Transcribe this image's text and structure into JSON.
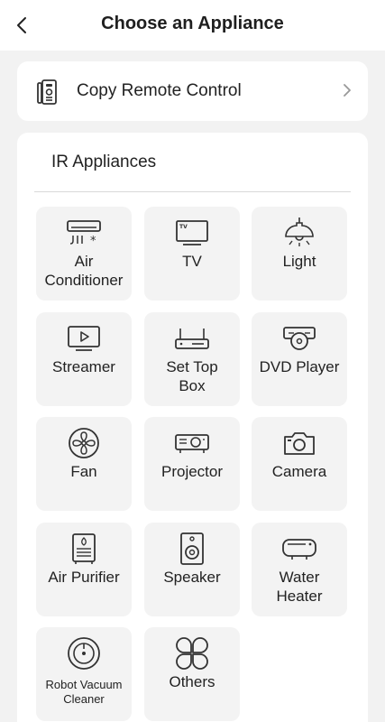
{
  "header": {
    "title": "Choose an Appliance",
    "back_icon": "chevron-left-icon"
  },
  "copy_remote": {
    "label": "Copy Remote Control",
    "icon": "remote-copy-icon",
    "chevron": "chevron-right-icon"
  },
  "section": {
    "title": "IR Appliances"
  },
  "appliances": [
    {
      "label": "Air\nConditioner",
      "icon": "air-conditioner-icon"
    },
    {
      "label": "TV",
      "icon": "tv-icon"
    },
    {
      "label": "Light",
      "icon": "light-icon"
    },
    {
      "label": "Streamer",
      "icon": "streamer-icon"
    },
    {
      "label": "Set Top\nBox",
      "icon": "set-top-box-icon"
    },
    {
      "label": "DVD Player",
      "icon": "dvd-player-icon"
    },
    {
      "label": "Fan",
      "icon": "fan-icon"
    },
    {
      "label": "Projector",
      "icon": "projector-icon"
    },
    {
      "label": "Camera",
      "icon": "camera-icon"
    },
    {
      "label": "Air Purifier",
      "icon": "air-purifier-icon"
    },
    {
      "label": "Speaker",
      "icon": "speaker-icon"
    },
    {
      "label": "Water\nHeater",
      "icon": "water-heater-icon"
    },
    {
      "label": "Robot Vacuum\nCleaner",
      "icon": "robot-vacuum-icon"
    },
    {
      "label": "Others",
      "icon": "others-icon"
    }
  ]
}
